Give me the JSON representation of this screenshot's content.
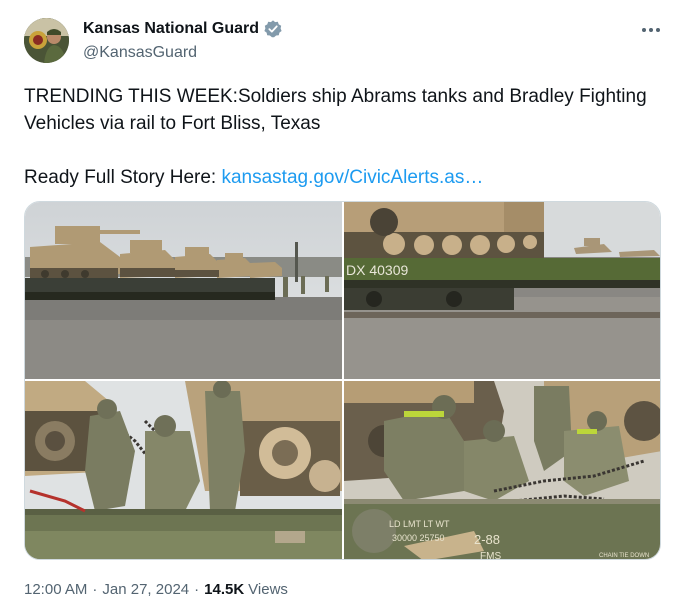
{
  "author": {
    "display_name": "Kansas National Guard",
    "handle": "@KansasGuard",
    "verified_color": "#829aab",
    "avatar": "avatar-icon"
  },
  "menu": {
    "icon": "more-icon"
  },
  "tweet": {
    "line1": "TRENDING THIS WEEK:Soldiers ship Abrams tanks and Bradley Fighting Vehicles via rail to Fort Bliss, Texas",
    "line2_prefix": "Ready Full Story Here: ",
    "link_text": "kansastag.gov/CivicAlerts.as…"
  },
  "media": {
    "photos": [
      "tanks-on-railcars-photo",
      "tank-on-flatcar-photo",
      "soldiers-chaining-tank-photo",
      "soldiers-securing-chains-photo"
    ],
    "flatcar_marking": "DX 40309",
    "railcar_stencil_1": "LD LMT LT WT",
    "railcar_stencil_2": "30000 25750",
    "railcar_number": "2-88",
    "railcar_code": "FMS",
    "chain_label": "CHAIN TIE DOWN"
  },
  "meta": {
    "time": "12:00 AM",
    "separator": "·",
    "date": "Jan 27, 2024",
    "views_count": "14.5K",
    "views_label": "Views"
  },
  "colors": {
    "link": "#1d9bf0",
    "secondary": "#536471",
    "border": "#cfd9de"
  }
}
